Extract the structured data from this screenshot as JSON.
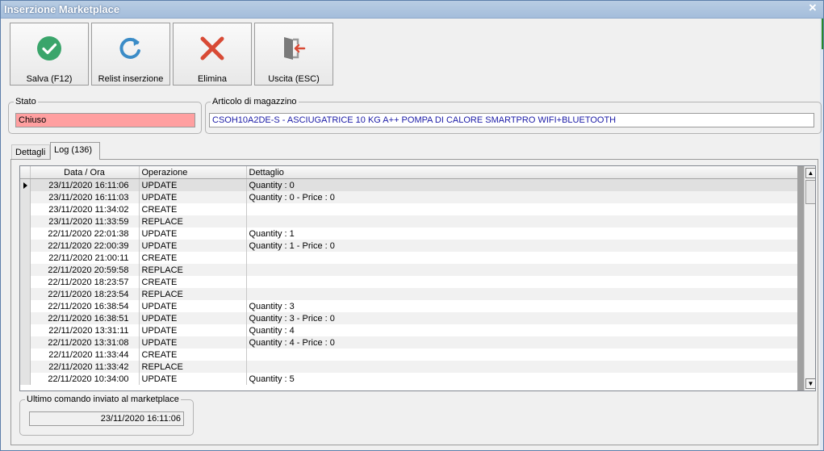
{
  "window": {
    "title": "Inserzione Marketplace",
    "close_glyph": "✕"
  },
  "toolbar": [
    {
      "label": "Salva (F12)",
      "icon": "check-circle-icon",
      "color": "#3aa56b"
    },
    {
      "label": "Relist inserzione",
      "icon": "refresh-icon",
      "color": "#3b8cc7"
    },
    {
      "label": "Elimina",
      "icon": "delete-x-icon",
      "color": "#d84a35"
    },
    {
      "label": "Uscita (ESC)",
      "icon": "exit-door-icon",
      "color": "#d84a35"
    }
  ],
  "stato": {
    "legend": "Stato",
    "value": "Chiuso",
    "bg": "#ff9fa0"
  },
  "articolo": {
    "legend": "Articolo di magazzino",
    "value": "CSOH10A2DE-S - ASCIUGATRICE 10 KG A++ POMPA DI CALORE SMARTPRO WIFI+BLUETOOTH",
    "text_color": "#1a1aa6"
  },
  "tabs": [
    {
      "label": "Dettagli",
      "active": false
    },
    {
      "label": "Log (136)",
      "active": true
    }
  ],
  "grid": {
    "columns": [
      "Data / Ora",
      "Operazione",
      "Dettaglio"
    ],
    "rows": [
      [
        "23/11/2020 16:11:06",
        "UPDATE",
        "Quantity : 0"
      ],
      [
        "23/11/2020 16:11:03",
        "UPDATE",
        "Quantity : 0 - Price : 0"
      ],
      [
        "23/11/2020 11:34:02",
        "CREATE",
        ""
      ],
      [
        "23/11/2020 11:33:59",
        "REPLACE",
        ""
      ],
      [
        "22/11/2020 22:01:38",
        "UPDATE",
        "Quantity : 1"
      ],
      [
        "22/11/2020 22:00:39",
        "UPDATE",
        "Quantity : 1 - Price : 0"
      ],
      [
        "22/11/2020 21:00:11",
        "CREATE",
        ""
      ],
      [
        "22/11/2020 20:59:58",
        "REPLACE",
        ""
      ],
      [
        "22/11/2020 18:23:57",
        "CREATE",
        ""
      ],
      [
        "22/11/2020 18:23:54",
        "REPLACE",
        ""
      ],
      [
        "22/11/2020 16:38:54",
        "UPDATE",
        "Quantity : 3"
      ],
      [
        "22/11/2020 16:38:51",
        "UPDATE",
        "Quantity : 3 - Price : 0"
      ],
      [
        "22/11/2020 13:31:11",
        "UPDATE",
        "Quantity : 4"
      ],
      [
        "22/11/2020 13:31:08",
        "UPDATE",
        "Quantity : 4 - Price : 0"
      ],
      [
        "22/11/2020 11:33:44",
        "CREATE",
        ""
      ],
      [
        "22/11/2020 11:33:42",
        "REPLACE",
        ""
      ],
      [
        "22/11/2020 10:34:00",
        "UPDATE",
        "Quantity : 5"
      ]
    ]
  },
  "ultimo": {
    "legend": "Ultimo comando inviato al marketplace",
    "value": "23/11/2020 16:11:06"
  }
}
